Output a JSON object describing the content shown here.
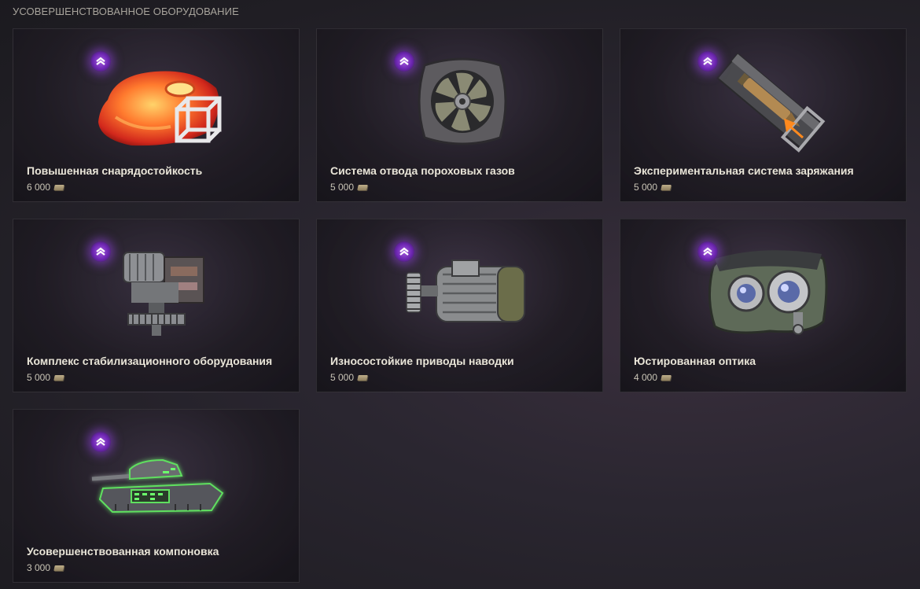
{
  "section_title": "УСОВЕРШЕНСТВОВАННОЕ ОБОРУДОВАНИЕ",
  "items": [
    {
      "name": "Повышенная снарядостойкость",
      "price": "6 000",
      "icon": "armor-icon"
    },
    {
      "name": "Система отвода пороховых газов",
      "price": "5 000",
      "icon": "fan-icon"
    },
    {
      "name": "Экспериментальная система заряжания",
      "price": "5 000",
      "icon": "loader-icon"
    },
    {
      "name": "Комплекс стабилизационного оборудования",
      "price": "5 000",
      "icon": "stabilizer-icon"
    },
    {
      "name": "Износостойкие приводы наводки",
      "price": "5 000",
      "icon": "motor-icon"
    },
    {
      "name": "Юстированная оптика",
      "price": "4 000",
      "icon": "optics-icon"
    },
    {
      "name": "Усовершенствованная компоновка",
      "price": "3 000",
      "icon": "tank-icon"
    }
  ],
  "colors": {
    "badge": "#8a3fd0",
    "name_text": "#e9e5d8",
    "price_text": "#c9c4b6",
    "credits": "#bfae8a"
  }
}
